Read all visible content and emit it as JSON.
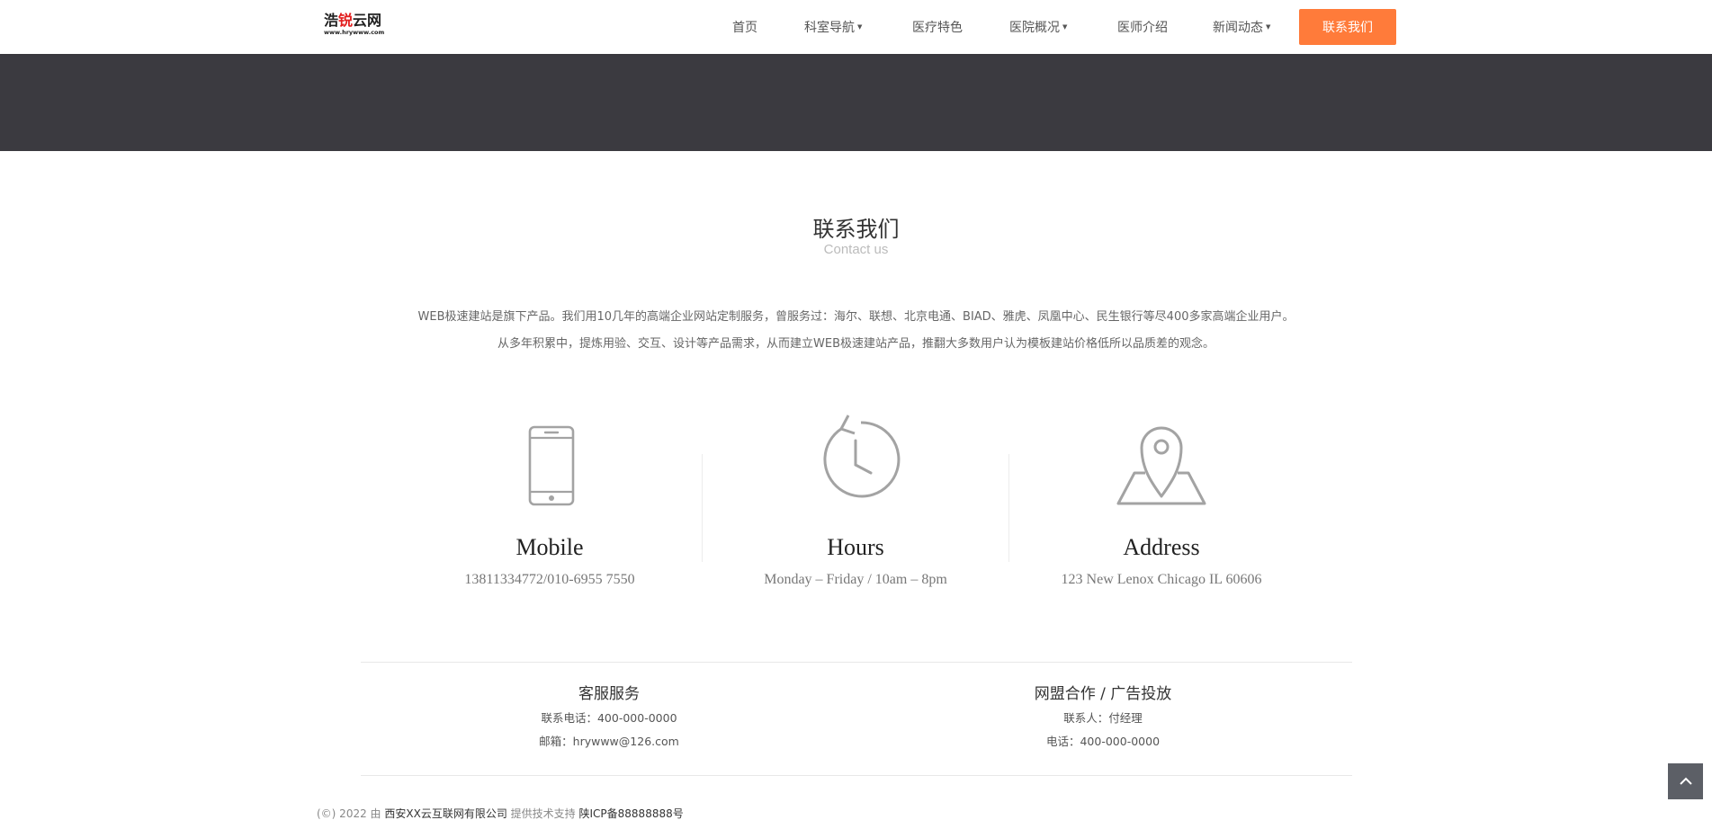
{
  "logo": {
    "main_a": "浩",
    "main_b": "锐",
    "main_c": "云网",
    "sub": "www.hrywww.com"
  },
  "nav": {
    "items": [
      {
        "label": "首页",
        "dropdown": false
      },
      {
        "label": "科室导航",
        "dropdown": true
      },
      {
        "label": "医疗特色",
        "dropdown": false
      },
      {
        "label": "医院概况",
        "dropdown": true
      },
      {
        "label": "医师介绍",
        "dropdown": false
      },
      {
        "label": "新闻动态",
        "dropdown": true
      }
    ],
    "cta": "联系我们",
    "caret": "▼"
  },
  "section": {
    "title": "联系我们",
    "subtitle": "Contact us"
  },
  "intro": {
    "line1": "WEB极速建站是旗下产品。我们用10几年的高端企业网站定制服务，曾服务过：海尔、联想、北京电通、BIAD、雅虎、凤凰中心、民生银行等尽400多家高端企业用户。",
    "line2": "从多年积累中，提炼用验、交互、设计等产品需求，从而建立WEB极速建站产品，推翻大多数用户认为模板建站价格低所以品质差的观念。"
  },
  "info": [
    {
      "title": "Mobile",
      "value": "13811334772/010-6955 7550",
      "icon": "phone-icon"
    },
    {
      "title": "Hours",
      "value": "Monday – Friday / 10am – 8pm",
      "icon": "clock-icon"
    },
    {
      "title": "Address",
      "value": "123  New Lenox  Chicago IL 60606",
      "icon": "map-pin-icon"
    }
  ],
  "service": {
    "left": {
      "heading": "客服服务",
      "line1": "联系电话：400-000-0000",
      "line2": "邮箱：hrywww@126.com"
    },
    "right": {
      "heading": "网盟合作 / 广告投放",
      "line1": "联系人：付经理",
      "line2": "电话：400-000-0000"
    }
  },
  "footer": {
    "copyright": "(©) 2022 由",
    "company": "西安XX云互联网有限公司",
    "support": "提供技术支持",
    "icp": "陕ICP备88888888号"
  },
  "colors": {
    "accent": "#ff7b3a",
    "banner": "#3b3a40",
    "totop": "#5c5f66"
  }
}
